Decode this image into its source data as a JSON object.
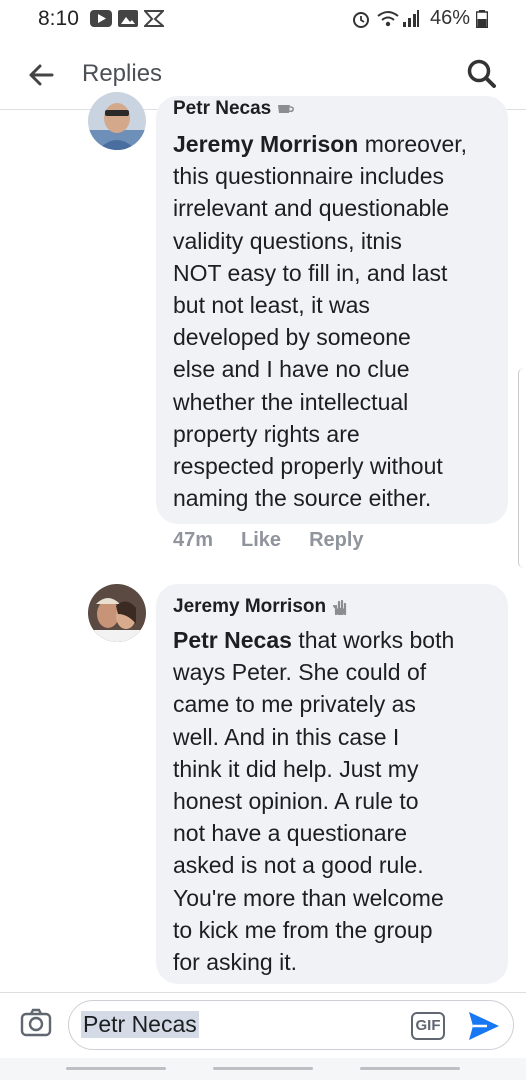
{
  "status_bar": {
    "time": "8:10",
    "battery": "46%",
    "icons": [
      "youtube-icon",
      "gallery-icon",
      "notification-icon",
      "alarm-icon",
      "wifi-icon",
      "signal-icon",
      "battery-icon"
    ]
  },
  "header": {
    "title": "Replies",
    "back_icon": "arrow-left-icon",
    "search_icon": "search-icon"
  },
  "comments": [
    {
      "author": "Petr Necas",
      "mention": "Jeremy Morrison",
      "lines": [
        "moreover,",
        "this questionnaire includes",
        "irrelevant and questionable",
        "validity questions, itnis",
        "NOT easy to fill in, and last",
        "but not least, it was",
        "developed by someone",
        "else and I have no clue",
        "whether the intellectual",
        "property rights are",
        "respected properly without",
        "naming the source either."
      ],
      "time": "47m",
      "like_label": "Like",
      "reply_label": "Reply"
    },
    {
      "author": "Jeremy Morrison",
      "mention": "Petr Necas",
      "lines": [
        "that works both",
        "ways Peter. She could of",
        "came to me privately as",
        "well. And in this case I",
        "think it did help. Just my",
        "honest opinion. A rule to",
        "not have a questionare",
        "asked is not a good rule.",
        "You're more than welcome",
        "to kick me from the group",
        "for asking it."
      ]
    }
  ],
  "composer": {
    "input_value": "Petr Necas",
    "gif_label": "GIF",
    "camera_icon": "camera-icon",
    "send_icon": "send-icon"
  },
  "colors": {
    "accent": "#1877f2",
    "bubble": "#f0f2f5",
    "meta_text": "#90949c"
  }
}
